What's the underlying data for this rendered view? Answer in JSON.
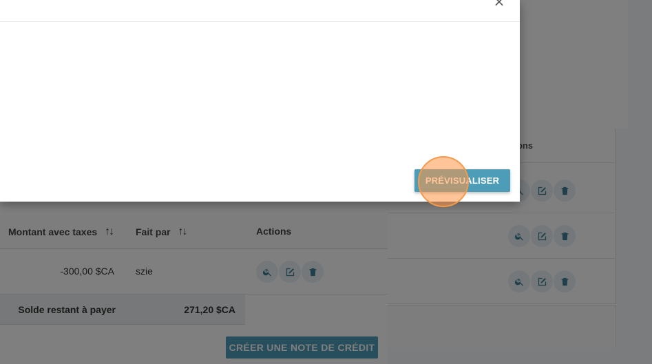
{
  "modal": {
    "close_symbol": "×",
    "preview_label": "PRÉVISUALISER"
  },
  "table": {
    "headers": {
      "amount": "Montant avec taxes",
      "by": "Fait par",
      "actions": "Actions"
    },
    "rows": [
      {
        "amount": "-300,00 $CA",
        "by": "szie"
      }
    ],
    "total": {
      "label": "Solde restant à payer",
      "value": "271,20 $CA"
    }
  },
  "create_credit_label": "CRÉER UNE NOTE DE CRÉDIT",
  "background_card": {
    "header_partial": "tions"
  },
  "icons": {
    "view": "zoom-in-icon",
    "edit": "edit-icon",
    "delete": "trash-icon"
  },
  "colors": {
    "primary": "#4d9db8",
    "icon": "#3e7f95",
    "click_marker": "#f39a4c"
  }
}
